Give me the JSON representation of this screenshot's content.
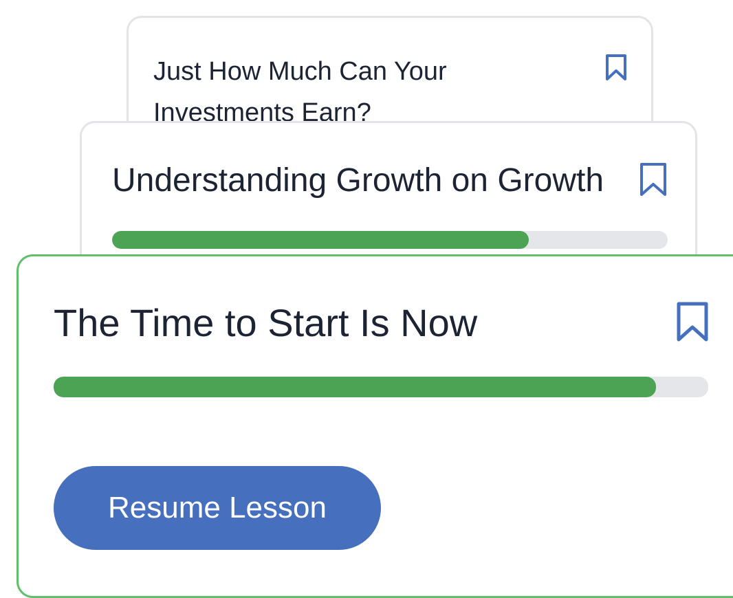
{
  "colors": {
    "bookmark": "#4670bd",
    "progress_fill": "#4da354",
    "progress_track": "#e4e6ea",
    "active_card_border": "#5fbf6a",
    "card_border": "#e3e4e8",
    "button_background": "#4670bd"
  },
  "lessons": [
    {
      "title": "Just How Much Can Your Investments Earn?",
      "bookmark_icon": "bookmark-outline-icon"
    },
    {
      "title": "Understanding Growth on Growth",
      "bookmark_icon": "bookmark-outline-icon",
      "progress": 0.75
    },
    {
      "title": "The Time to Start Is Now",
      "bookmark_icon": "bookmark-outline-icon",
      "progress": 0.92,
      "action_label": "Resume Lesson"
    }
  ]
}
